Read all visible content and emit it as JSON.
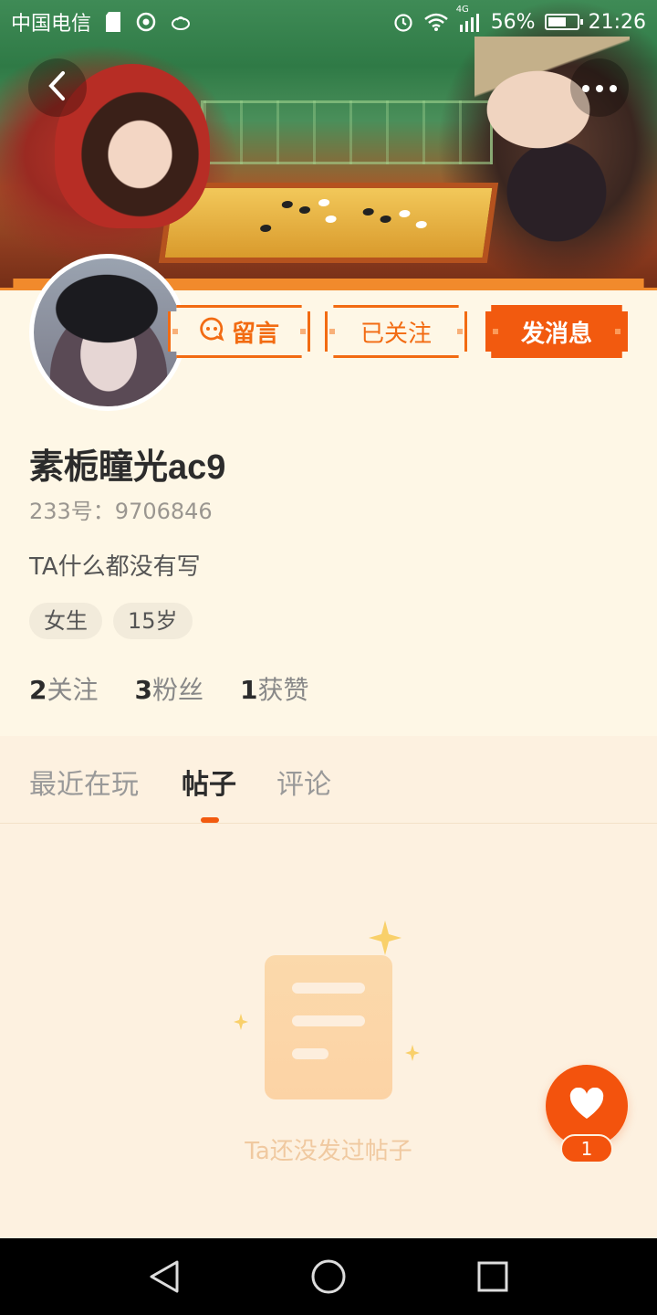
{
  "status_bar": {
    "carrier": "中国电信",
    "network": "4G",
    "battery": "56%",
    "battery_level": 0.56,
    "time": "21:26",
    "icons": [
      "sd-card-icon",
      "circle-dot-icon",
      "app-notification-icon",
      "alarm-icon",
      "wifi-icon",
      "signal-icon",
      "battery-icon"
    ]
  },
  "header": {
    "back_icon": "chevron-left-icon",
    "more_icon": "more-dots-icon"
  },
  "actions": {
    "message_label": "留言",
    "follow_label": "已关注",
    "chat_label": "发消息",
    "message_icon": "speech-bubble-icon"
  },
  "profile": {
    "username": "素栀瞳光ac9",
    "uid_text": "233号：9706846",
    "bio": "TA什么都没有写",
    "tags": [
      "女生",
      "15岁"
    ],
    "stats": [
      {
        "num": "2",
        "label": "关注"
      },
      {
        "num": "3",
        "label": "粉丝"
      },
      {
        "num": "1",
        "label": "获赞"
      }
    ]
  },
  "tabs": {
    "items": [
      "最近在玩",
      "帖子",
      "评论"
    ],
    "active": "帖子"
  },
  "empty_state": {
    "text": "Ta还没发过帖子",
    "icon": "document-icon"
  },
  "fab": {
    "icon": "heart-icon",
    "count": "1"
  },
  "colors": {
    "accent": "#f25a0f",
    "background": "#fdf1e0",
    "card": "#fef7e6"
  }
}
